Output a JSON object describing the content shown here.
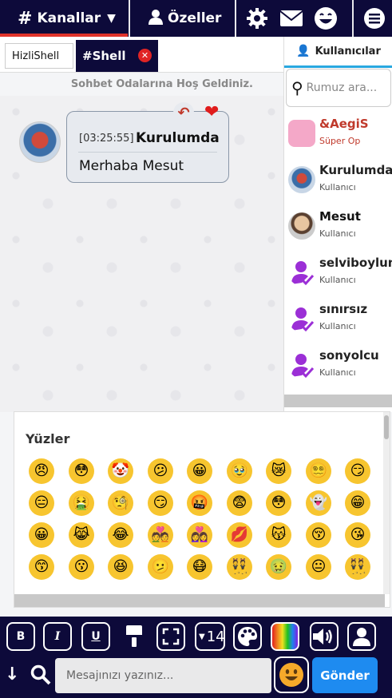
{
  "topbar": {
    "channels_label": "Kanallar",
    "private_label": "Özeller"
  },
  "tabs": [
    {
      "label": "HizliShell"
    },
    {
      "label": "#Shell"
    }
  ],
  "welcome_text": "Sohbet Odalarına Hoş Geldiniz.",
  "message": {
    "time": "[03:25:55]",
    "nick": "Kurulumda",
    "text": "Merhaba Mesut"
  },
  "sidebar": {
    "title": "Kullanıcılar",
    "search_placeholder": "Rumuz ara...",
    "users": [
      {
        "name": "&AegiS",
        "role": "Süper Op",
        "name_color": "#c0392b",
        "role_color": "#c0392b"
      },
      {
        "name": "Kurulumda",
        "role": "Kullanıcı"
      },
      {
        "name": "Mesut",
        "role": "Kullanıcı"
      },
      {
        "name": "selviboylum",
        "role": "Kullanıcı"
      },
      {
        "name": "sınırsız",
        "role": "Kullanıcı"
      },
      {
        "name": "sonyolcu",
        "role": "Kullanıcı"
      }
    ]
  },
  "emoji_panel": {
    "title": "Yüzler",
    "rows": [
      [
        "😠",
        "😳",
        "🤡",
        "😕",
        "😀",
        "🥹",
        "😿",
        "😵‍💫",
        "😏"
      ],
      [
        "😑",
        "🤮",
        "🧐",
        "😏",
        "🤬",
        "😨",
        "😳",
        "👻",
        "😁"
      ],
      [
        "😀",
        "😹",
        "😂",
        "💑",
        "👩‍❤️‍👩",
        "💋",
        "😽",
        "😚",
        "😘"
      ],
      [
        "😙",
        "😗",
        "😆",
        "🫤",
        "😷",
        "👯",
        "🤢",
        "😐",
        "👯"
      ]
    ]
  },
  "toolbar": {
    "bold": "B",
    "italic": "I",
    "underline": "U",
    "font_size": "14",
    "message_placeholder": "Mesajınızı yazınız...",
    "send_label": "Gönder"
  },
  "colors": {
    "navy": "#0d0a3a",
    "accent_red": "#e0332a",
    "send_blue": "#1e8bf0"
  }
}
